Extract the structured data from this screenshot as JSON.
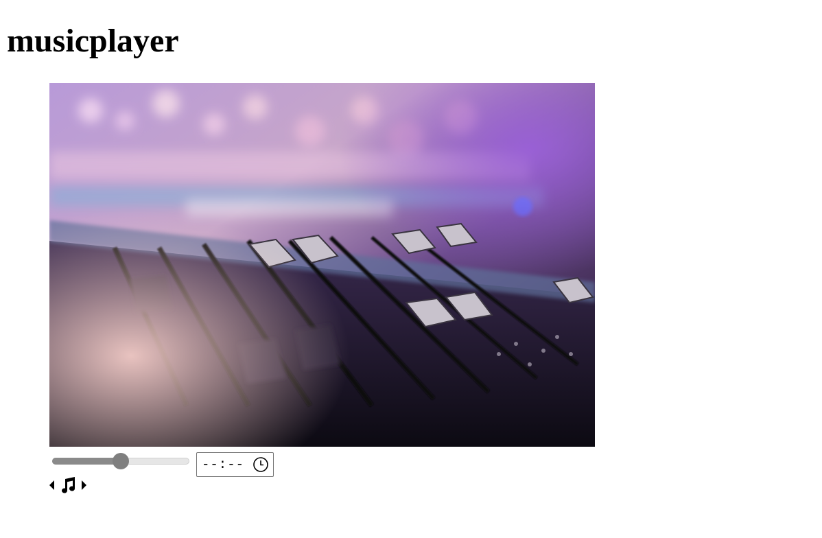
{
  "header": {
    "title": "musicplayer"
  },
  "artwork": {
    "icon": "mixing-console-photo"
  },
  "player": {
    "volume_fraction": 0.5,
    "time_value": "--:--",
    "clock_icon": "clock-icon",
    "prev_icon": "caret-left-icon",
    "note_icon": "music-note-icon",
    "next_icon": "caret-right-icon"
  }
}
